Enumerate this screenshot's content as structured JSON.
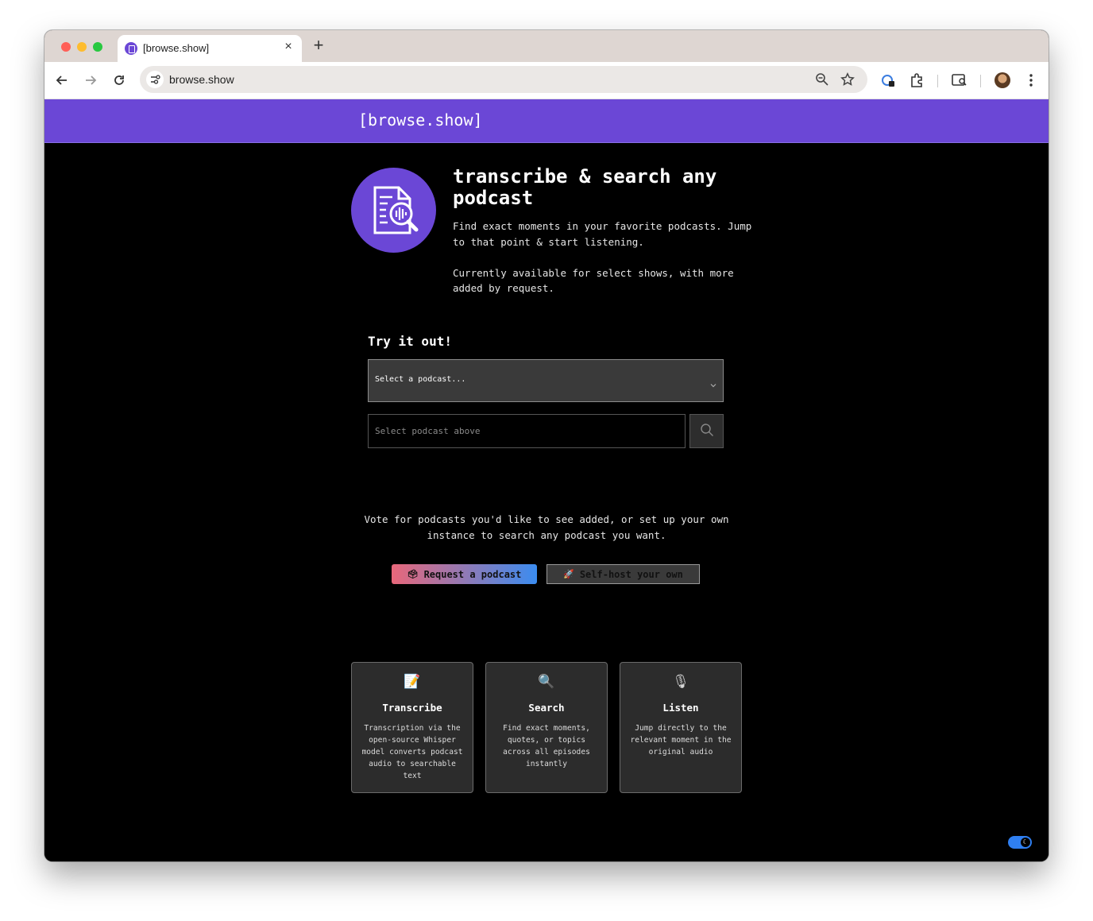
{
  "browser": {
    "tab_title": "[browse.show]",
    "address": "browse.show",
    "new_tab_label": "+",
    "close_tab_label": "×"
  },
  "site": {
    "title": "[browse.show]"
  },
  "hero": {
    "title": "transcribe & search any podcast",
    "description": "Find exact moments in your favorite podcasts. Jump to that point & start listening.",
    "availability": "Currently available for select shows, with more added by request."
  },
  "try": {
    "heading": "Try it out!",
    "select_placeholder": "Select a podcast...",
    "search_placeholder": "Select podcast above"
  },
  "vote": {
    "text": "Vote for podcasts you'd like to see added, or set up your own instance to search any podcast you want.",
    "request_emoji": "🗳",
    "request_label": "Request a podcast",
    "selfhost_emoji": "🚀",
    "selfhost_label": "Self-host your own"
  },
  "features": [
    {
      "icon": "📝",
      "title": "Transcribe",
      "description": "Transcription via the open-source Whisper model converts podcast audio to searchable text"
    },
    {
      "icon": "🔍",
      "title": "Search",
      "description": "Find exact moments, quotes, or topics across all episodes instantly"
    },
    {
      "icon": "🎙",
      "title": "Listen",
      "description": "Jump directly to the relevant moment in the original audio"
    }
  ],
  "theme_toggle": {
    "icon": "☾"
  }
}
